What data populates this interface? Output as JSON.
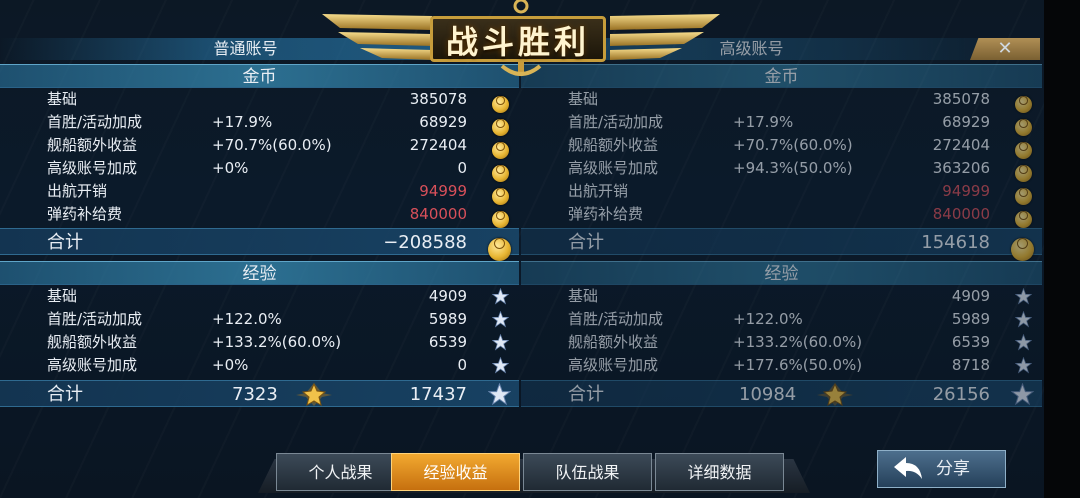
{
  "banner": {
    "title": "战斗胜利"
  },
  "close_label": "✕",
  "left": {
    "account": "普通账号",
    "gold_header": "金币",
    "gold_rows": [
      {
        "label": "基础",
        "pct": "",
        "value": "385078"
      },
      {
        "label": "首胜/活动加成",
        "pct": "+17.9%",
        "value": "68929"
      },
      {
        "label": "舰船额外收益",
        "pct": "+70.7%(60.0%)",
        "value": "272404"
      },
      {
        "label": "高级账号加成",
        "pct": "+0%",
        "value": "0"
      },
      {
        "label": "出航开销",
        "pct": "",
        "value": "94999"
      },
      {
        "label": "弹药补给费",
        "pct": "",
        "value": "840000"
      }
    ],
    "gold_total_label": "合计",
    "gold_total": "−208588",
    "exp_header": "经验",
    "exp_rows": [
      {
        "label": "基础",
        "pct": "",
        "value": "4909"
      },
      {
        "label": "首胜/活动加成",
        "pct": "+122.0%",
        "value": "5989"
      },
      {
        "label": "舰船额外收益",
        "pct": "+133.2%(60.0%)",
        "value": "6539"
      },
      {
        "label": "高级账号加成",
        "pct": "+0%",
        "value": "0"
      }
    ],
    "exp_total_label": "合计",
    "exp_total_mid": "7323",
    "exp_total": "17437"
  },
  "right": {
    "account": "高级账号",
    "gold_header": "金币",
    "gold_rows": [
      {
        "label": "基础",
        "pct": "",
        "value": "385078"
      },
      {
        "label": "首胜/活动加成",
        "pct": "+17.9%",
        "value": "68929"
      },
      {
        "label": "舰船额外收益",
        "pct": "+70.7%(60.0%)",
        "value": "272404"
      },
      {
        "label": "高级账号加成",
        "pct": "+94.3%(50.0%)",
        "value": "363206"
      },
      {
        "label": "出航开销",
        "pct": "",
        "value": "94999"
      },
      {
        "label": "弹药补给费",
        "pct": "",
        "value": "840000"
      }
    ],
    "gold_total_label": "合计",
    "gold_total": "154618",
    "exp_header": "经验",
    "exp_rows": [
      {
        "label": "基础",
        "pct": "",
        "value": "4909"
      },
      {
        "label": "首胜/活动加成",
        "pct": "+122.0%",
        "value": "5989"
      },
      {
        "label": "舰船额外收益",
        "pct": "+133.2%(60.0%)",
        "value": "6539"
      },
      {
        "label": "高级账号加成",
        "pct": "+177.6%(50.0%)",
        "value": "8718"
      }
    ],
    "exp_total_label": "合计",
    "exp_total_mid": "10984",
    "exp_total": "26156"
  },
  "tabs": [
    "个人战果",
    "经验收益",
    "队伍战果",
    "详细数据"
  ],
  "active_tab": 1,
  "share_label": "分享",
  "colors": {
    "negative": "#d8505a",
    "active_tab": "#f2a930",
    "coin": "#e7b532",
    "star": "#dfe8f5"
  },
  "icons": {
    "gold": "coin-icon",
    "exp": "star-icon",
    "share": "share-arrow-icon",
    "close": "close-icon"
  }
}
